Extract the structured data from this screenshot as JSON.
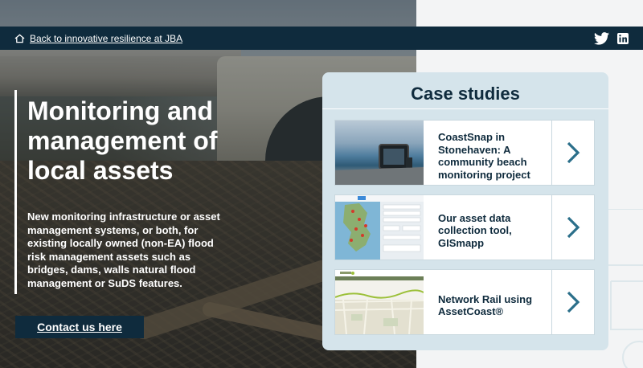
{
  "nav": {
    "back_link": "Back to innovative resilience at JBA",
    "home_icon": "home-icon",
    "social": [
      "twitter-icon",
      "linkedin-icon"
    ]
  },
  "hero": {
    "title": "Monitoring and management of local assets",
    "description": "New monitoring infrastructure or asset management systems, or both, for existing locally owned (non-EA) flood risk management assets such as bridges, dams, walls natural flood management or SuDS features.",
    "contact_button": "Contact us here"
  },
  "case_studies": {
    "title": "Case studies",
    "items": [
      {
        "label": "CoastSnap in Stonehaven: A community beach monitoring project",
        "icon": "chevron-right-icon"
      },
      {
        "label": "Our asset data collection tool, GISmapp",
        "icon": "chevron-right-icon"
      },
      {
        "label": "Network Rail using AssetCoast®",
        "icon": "chevron-right-icon"
      }
    ]
  },
  "colors": {
    "navy": "#0f2b3d",
    "panel": "#d5e4eb",
    "chevron": "#2b6f8a"
  }
}
